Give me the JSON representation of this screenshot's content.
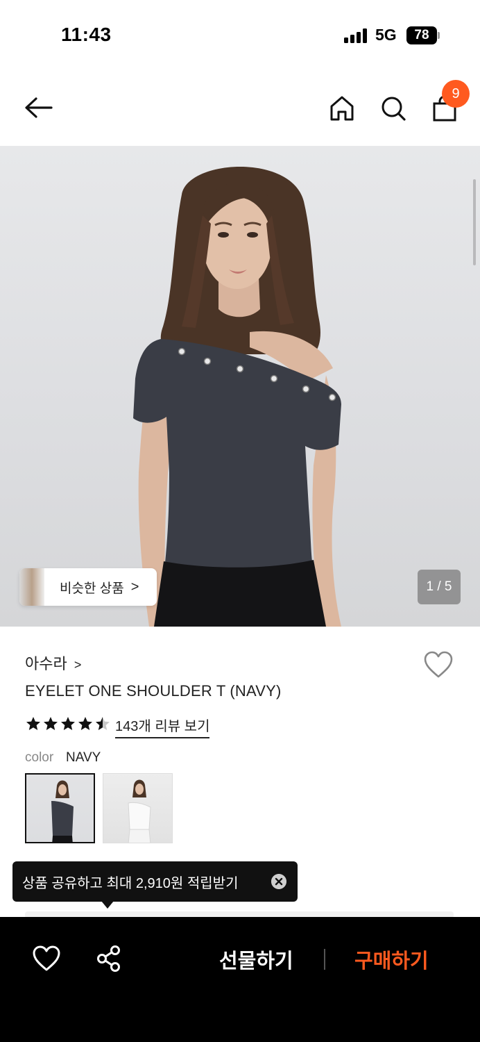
{
  "status_bar": {
    "time": "11:43",
    "network": "5G",
    "battery": "78"
  },
  "header": {
    "cart_count": "9"
  },
  "gallery": {
    "similar_label": "비슷한 상품",
    "similar_chevron": ">",
    "page_counter": "1 / 5"
  },
  "product": {
    "brand": "아수라",
    "brand_chevron": ">",
    "title": "EYELET ONE SHOULDER T (NAVY)",
    "rating": 4.5,
    "review_link": "143개 리뷰 보기",
    "color_label": "color",
    "color_value": "NAVY",
    "swatches": [
      "navy",
      "white"
    ]
  },
  "tooltip": {
    "text": "상품 공유하고 최대 2,910원 적립받기"
  },
  "bottom_bar": {
    "gift_label": "선물하기",
    "buy_label": "구매하기"
  },
  "colors": {
    "accent": "#ff5a1f",
    "bar_bg": "#000000",
    "shirt": "#3a3d46"
  }
}
